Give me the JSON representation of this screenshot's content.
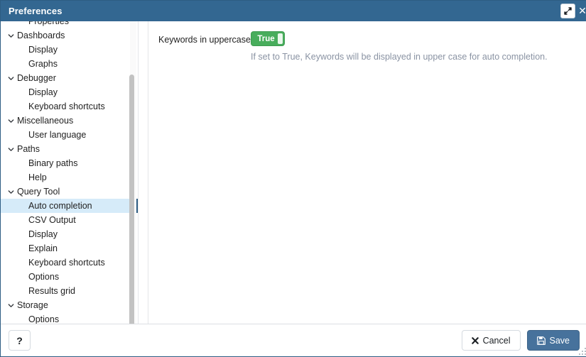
{
  "window": {
    "title": "Preferences",
    "maximize_icon": "expand-diagonal-icon",
    "close_icon": "close-icon"
  },
  "sidebar": {
    "items": [
      {
        "label": "Properties",
        "type": "leaf",
        "selected": false,
        "clipped": true
      },
      {
        "label": "Dashboards",
        "type": "group",
        "selected": false
      },
      {
        "label": "Display",
        "type": "leaf",
        "selected": false
      },
      {
        "label": "Graphs",
        "type": "leaf",
        "selected": false
      },
      {
        "label": "Debugger",
        "type": "group",
        "selected": false
      },
      {
        "label": "Display",
        "type": "leaf",
        "selected": false
      },
      {
        "label": "Keyboard shortcuts",
        "type": "leaf",
        "selected": false
      },
      {
        "label": "Miscellaneous",
        "type": "group",
        "selected": false
      },
      {
        "label": "User language",
        "type": "leaf",
        "selected": false
      },
      {
        "label": "Paths",
        "type": "group",
        "selected": false
      },
      {
        "label": "Binary paths",
        "type": "leaf",
        "selected": false
      },
      {
        "label": "Help",
        "type": "leaf",
        "selected": false
      },
      {
        "label": "Query Tool",
        "type": "group",
        "selected": false
      },
      {
        "label": "Auto completion",
        "type": "leaf",
        "selected": true
      },
      {
        "label": "CSV Output",
        "type": "leaf",
        "selected": false
      },
      {
        "label": "Display",
        "type": "leaf",
        "selected": false
      },
      {
        "label": "Explain",
        "type": "leaf",
        "selected": false
      },
      {
        "label": "Keyboard shortcuts",
        "type": "leaf",
        "selected": false
      },
      {
        "label": "Options",
        "type": "leaf",
        "selected": false
      },
      {
        "label": "Results grid",
        "type": "leaf",
        "selected": false
      },
      {
        "label": "Storage",
        "type": "group",
        "selected": false
      },
      {
        "label": "Options",
        "type": "leaf",
        "selected": false
      }
    ],
    "expand_icon": "chevron-down-icon",
    "selected_accent_color": "#2e5d83",
    "selected_background_color": "#d6ebf9"
  },
  "content": {
    "fields": [
      {
        "label": "Keywords in uppercase",
        "control": "toggle",
        "value": "True",
        "value_color": "#48ad5c",
        "help": "If set to True, Keywords will be displayed in upper case for auto completion."
      }
    ]
  },
  "footer": {
    "help_label": "?",
    "cancel_label": "Cancel",
    "cancel_icon": "close-x-icon",
    "save_label": "Save",
    "save_icon": "floppy-disk-save-icon",
    "save_color": "#47729c"
  }
}
